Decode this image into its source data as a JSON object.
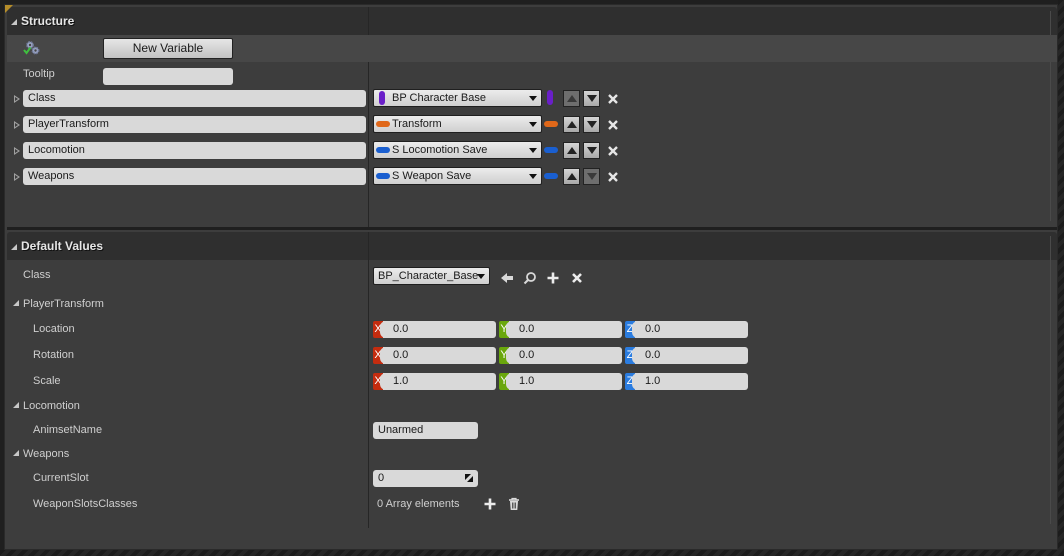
{
  "structure": {
    "title": "Structure",
    "new_variable_label": "New Variable",
    "tooltip_label": "Tooltip",
    "tooltip_value": "",
    "variables": [
      {
        "name": "Class",
        "type": "BP Character Base",
        "pin_color": "#6a1fc9",
        "pin_shape": "vertical",
        "up_enabled": false,
        "down_enabled": true
      },
      {
        "name": "PlayerTransform",
        "type": "Transform",
        "pin_color": "#e0681a",
        "pin_shape": "horizontal",
        "up_enabled": true,
        "down_enabled": true
      },
      {
        "name": "Locomotion",
        "type": "S Locomotion Save",
        "pin_color": "#1a5fd0",
        "pin_shape": "horizontal",
        "up_enabled": true,
        "down_enabled": true
      },
      {
        "name": "Weapons",
        "type": "S Weapon Save",
        "pin_color": "#1a5fd0",
        "pin_shape": "horizontal",
        "up_enabled": true,
        "down_enabled": false
      }
    ]
  },
  "defaults": {
    "title": "Default Values",
    "class_label": "Class",
    "class_value": "BP_Character_Base",
    "player_transform_label": "PlayerTransform",
    "location_label": "Location",
    "rotation_label": "Rotation",
    "scale_label": "Scale",
    "location": {
      "x": "0.0",
      "y": "0.0",
      "z": "0.0"
    },
    "rotation": {
      "x": "0.0",
      "y": "0.0",
      "z": "0.0"
    },
    "scale": {
      "x": "1.0",
      "y": "1.0",
      "z": "1.0"
    },
    "axis_labels": {
      "x": "X",
      "y": "Y",
      "z": "Z"
    },
    "axis_colors": {
      "x": "#c42c0f",
      "y": "#6aa70c",
      "z": "#2a7ce0"
    },
    "locomotion_label": "Locomotion",
    "animset_label": "AnimsetName",
    "animset_value": "Unarmed",
    "weapons_label": "Weapons",
    "current_slot_label": "CurrentSlot",
    "current_slot_value": "0",
    "weapon_slots_label": "WeaponSlotsClasses",
    "weapon_slots_value": "0 Array elements"
  }
}
